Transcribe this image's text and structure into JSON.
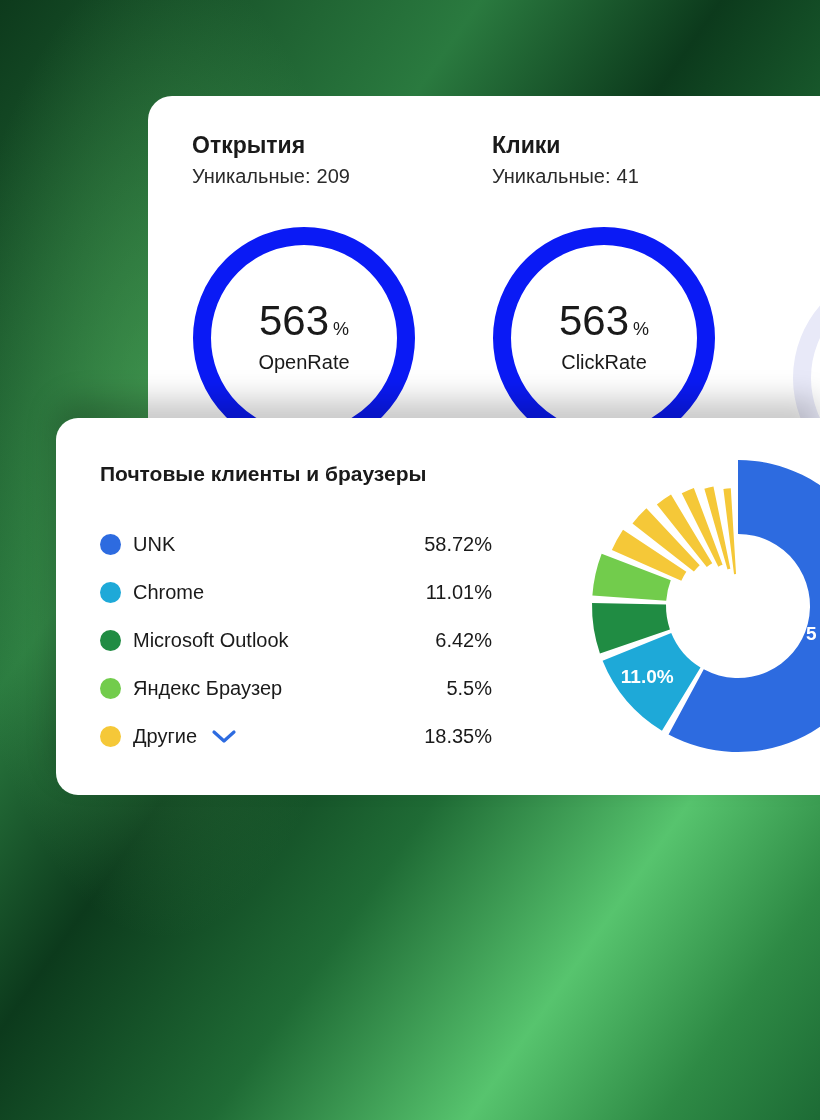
{
  "metrics": [
    {
      "title": "Открытия",
      "unique_label": "Уникальные:",
      "unique_value": "209",
      "value": "563",
      "unit": "%",
      "caption": "OpenRate"
    },
    {
      "title": "Клики",
      "unique_label": "Уникальные:",
      "unique_value": "41",
      "value": "563",
      "unit": "%",
      "caption": "ClickRate"
    }
  ],
  "clients": {
    "title": "Почтовые клиенты и браузеры",
    "items": [
      {
        "kind": "client",
        "name": "UNK",
        "value": "58.72%",
        "color": "#2d6be0",
        "chart_label": "5"
      },
      {
        "kind": "client",
        "name": "Chrome",
        "value": "11.01%",
        "color": "#1ea9d8",
        "chart_label": "11.0%"
      },
      {
        "kind": "client",
        "name": "Microsoft Outlook",
        "value": "6.42%",
        "color": "#208c43"
      },
      {
        "kind": "client",
        "name": "Яндекс Браузер",
        "value": "5.5%",
        "color": "#72cc4c"
      },
      {
        "kind": "group",
        "name": "Другие",
        "value": "18.35%",
        "color": "#f5c838"
      }
    ]
  }
}
